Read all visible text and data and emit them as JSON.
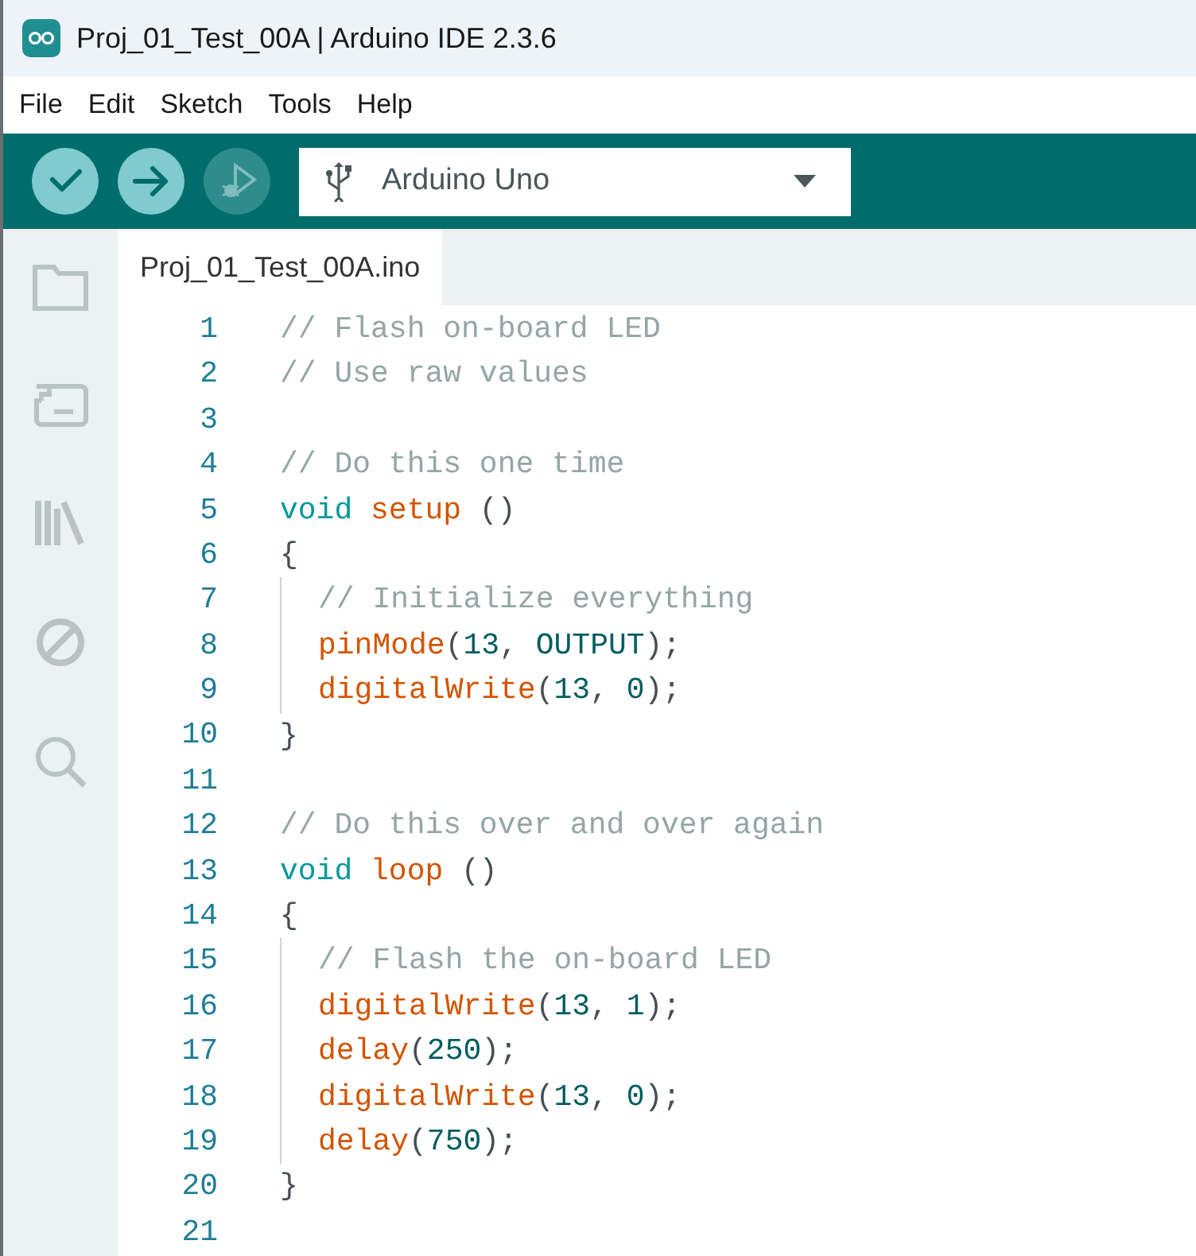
{
  "window": {
    "title": "Proj_01_Test_00A | Arduino IDE 2.3.6"
  },
  "menu": [
    "File",
    "Edit",
    "Sketch",
    "Tools",
    "Help"
  ],
  "toolbar": {
    "buttons": [
      {
        "kind": "verify",
        "disabled": false
      },
      {
        "kind": "upload",
        "disabled": false
      },
      {
        "kind": "debug",
        "disabled": true
      }
    ],
    "board_selector": {
      "value": "Arduino Uno"
    }
  },
  "sidebar": {
    "items": [
      {
        "kind": "sketchbook"
      },
      {
        "kind": "boards"
      },
      {
        "kind": "library"
      },
      {
        "kind": "debug"
      },
      {
        "kind": "search"
      }
    ]
  },
  "tabs": [
    {
      "label": "Proj_01_Test_00A.ino",
      "selected": true
    }
  ],
  "editor": {
    "lines": [
      {
        "number": "1",
        "indented": false,
        "tokens": [
          {
            "kind": "comment",
            "text": "// Flash on-board LED"
          }
        ]
      },
      {
        "number": "2",
        "indented": false,
        "tokens": [
          {
            "kind": "comment",
            "text": "// Use raw values"
          }
        ]
      },
      {
        "number": "3",
        "indented": false
      },
      {
        "number": "4",
        "indented": false,
        "tokens": [
          {
            "kind": "comment",
            "text": "// Do this one time"
          }
        ]
      },
      {
        "number": "5",
        "indented": false,
        "tokens": [
          {
            "kind": "keyword",
            "text": "void "
          },
          {
            "kind": "function",
            "text": "setup"
          },
          {
            "kind": "plain",
            "text": " ()"
          }
        ]
      },
      {
        "number": "6",
        "indented": false,
        "tokens": [
          {
            "kind": "plain",
            "text": "{"
          }
        ]
      },
      {
        "number": "7",
        "indented": true,
        "tokens": [
          {
            "kind": "comment",
            "text": "// Initialize everything"
          }
        ]
      },
      {
        "number": "8",
        "indented": true,
        "tokens": [
          {
            "kind": "function",
            "text": "pinMode"
          },
          {
            "kind": "plain",
            "text": "("
          },
          {
            "kind": "number",
            "text": "13"
          },
          {
            "kind": "plain",
            "text": ", "
          },
          {
            "kind": "number",
            "text": "OUTPUT"
          },
          {
            "kind": "plain",
            "text": ");"
          }
        ]
      },
      {
        "number": "9",
        "indented": true,
        "tokens": [
          {
            "kind": "function",
            "text": "digitalWrite"
          },
          {
            "kind": "plain",
            "text": "("
          },
          {
            "kind": "number",
            "text": "13"
          },
          {
            "kind": "plain",
            "text": ", "
          },
          {
            "kind": "number",
            "text": "0"
          },
          {
            "kind": "plain",
            "text": ");"
          }
        ]
      },
      {
        "number": "10",
        "indented": false,
        "tokens": [
          {
            "kind": "plain",
            "text": "}"
          }
        ]
      },
      {
        "number": "11",
        "indented": false
      },
      {
        "number": "12",
        "indented": false,
        "tokens": [
          {
            "kind": "comment",
            "text": "// Do this over and over again"
          }
        ]
      },
      {
        "number": "13",
        "indented": false,
        "tokens": [
          {
            "kind": "keyword",
            "text": "void "
          },
          {
            "kind": "function",
            "text": "loop"
          },
          {
            "kind": "plain",
            "text": " ()"
          }
        ]
      },
      {
        "number": "14",
        "indented": false,
        "tokens": [
          {
            "kind": "plain",
            "text": "{"
          }
        ]
      },
      {
        "number": "15",
        "indented": true,
        "tokens": [
          {
            "kind": "comment",
            "text": "// Flash the on-board LED"
          }
        ]
      },
      {
        "number": "16",
        "indented": true,
        "tokens": [
          {
            "kind": "function",
            "text": "digitalWrite"
          },
          {
            "kind": "plain",
            "text": "("
          },
          {
            "kind": "number",
            "text": "13"
          },
          {
            "kind": "plain",
            "text": ", "
          },
          {
            "kind": "number",
            "text": "1"
          },
          {
            "kind": "plain",
            "text": ");"
          }
        ]
      },
      {
        "number": "17",
        "indented": true,
        "tokens": [
          {
            "kind": "function",
            "text": "delay"
          },
          {
            "kind": "plain",
            "text": "("
          },
          {
            "kind": "number",
            "text": "250"
          },
          {
            "kind": "plain",
            "text": ");"
          }
        ]
      },
      {
        "number": "18",
        "indented": true,
        "tokens": [
          {
            "kind": "function",
            "text": "digitalWrite"
          },
          {
            "kind": "plain",
            "text": "("
          },
          {
            "kind": "number",
            "text": "13"
          },
          {
            "kind": "plain",
            "text": ", "
          },
          {
            "kind": "number",
            "text": "0"
          },
          {
            "kind": "plain",
            "text": ");"
          }
        ]
      },
      {
        "number": "19",
        "indented": true,
        "tokens": [
          {
            "kind": "function",
            "text": "delay"
          },
          {
            "kind": "plain",
            "text": "("
          },
          {
            "kind": "number",
            "text": "750"
          },
          {
            "kind": "plain",
            "text": ");"
          }
        ]
      },
      {
        "number": "20",
        "indented": false,
        "tokens": [
          {
            "kind": "plain",
            "text": "}"
          }
        ]
      },
      {
        "number": "21",
        "indented": false
      }
    ]
  }
}
